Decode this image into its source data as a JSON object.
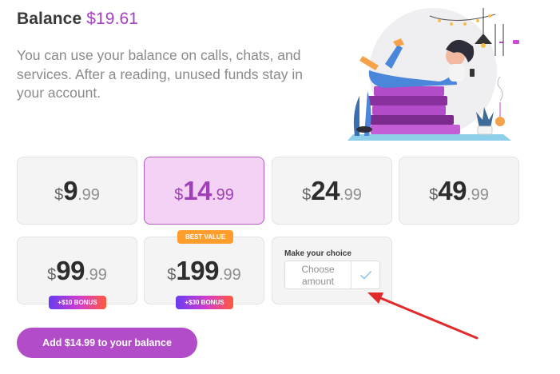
{
  "header": {
    "title_label": "Balance",
    "balance": "$19.61"
  },
  "description": "You can use your balance on calls, chats, and services. After a reading, unused funds stay in your account.",
  "illustration": {
    "icon": "woman-reading-phone-illustration"
  },
  "options": [
    {
      "currency": "$",
      "amount": "9",
      "cents": ".99",
      "selected": false
    },
    {
      "currency": "$",
      "amount": "14",
      "cents": ".99",
      "selected": true
    },
    {
      "currency": "$",
      "amount": "24",
      "cents": ".99",
      "selected": false
    },
    {
      "currency": "$",
      "amount": "49",
      "cents": ".99",
      "selected": false
    },
    {
      "currency": "$",
      "amount": "99",
      "cents": ".99",
      "selected": false,
      "badge": "+$10 BONUS"
    },
    {
      "currency": "$",
      "amount": "199",
      "cents": ".99",
      "selected": false,
      "badge": "+$30 BONUS",
      "top_badge": "BEST VALUE"
    }
  ],
  "custom": {
    "title": "Make your choice",
    "placeholder_line1": "Choose",
    "placeholder_line2": "amount",
    "confirm_icon": "checkmark-icon"
  },
  "add_button_label": "Add $14.99 to your balance",
  "annotation": {
    "icon": "red-arrow-annotation",
    "color": "#e32a2a"
  },
  "colors": {
    "accent": "#b24cc8",
    "selected_bg": "#f3d2f5",
    "best_value": "#ff9e2c"
  }
}
